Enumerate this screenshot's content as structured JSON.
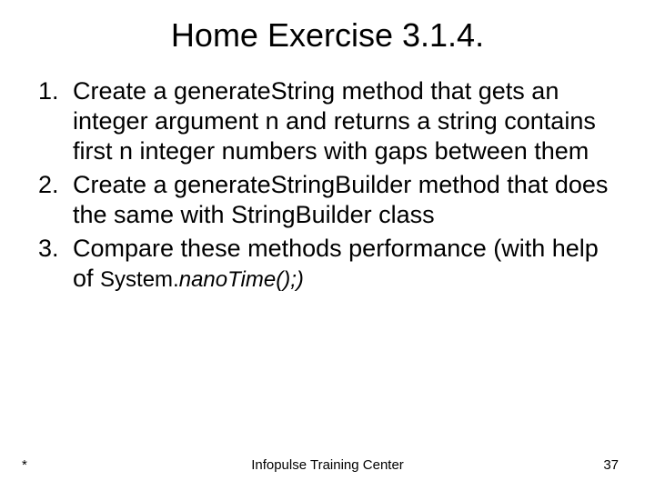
{
  "title": "Home Exercise 3.1.4.",
  "items": [
    "Create a generateString method that gets an integer argument n and returns a string contains first n integer numbers with gaps between them",
    "Create a generateStringBuilder method that does the same with StringBuilder class",
    "Compare these methods performance (with help of "
  ],
  "code_last_plain": "System.",
  "code_last_ital": "nanoTime();)",
  "footer": {
    "left": "*",
    "center": "Infopulse Training Center",
    "right": "37"
  }
}
